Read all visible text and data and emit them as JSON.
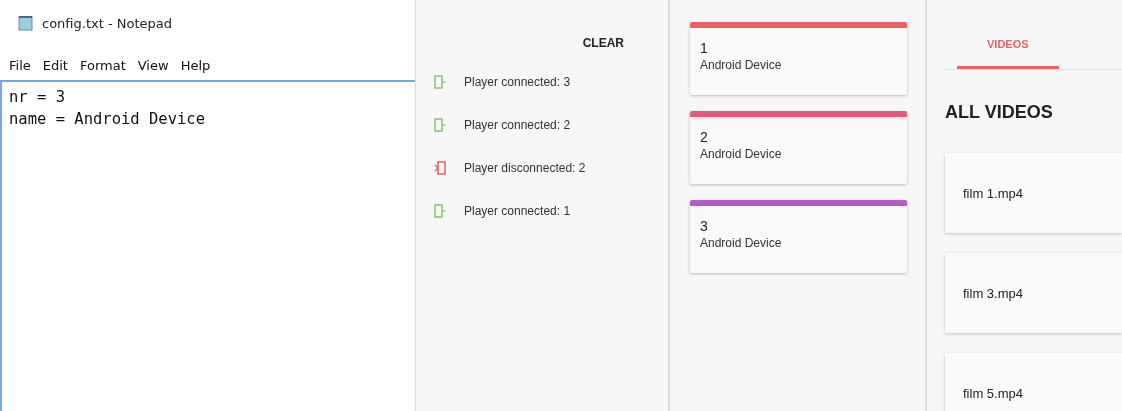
{
  "notepad": {
    "title": "config.txt - Notepad",
    "menu": [
      "File",
      "Edit",
      "Format",
      "View",
      "Help"
    ],
    "lines": [
      "nr = 3",
      "name = Android Device"
    ]
  },
  "events": {
    "clear_label": "CLEAR",
    "items": [
      {
        "kind": "connected",
        "text": "Player connected: 3"
      },
      {
        "kind": "connected",
        "text": "Player connected: 2"
      },
      {
        "kind": "disconnected",
        "text": "Player disconnected: 2"
      },
      {
        "kind": "connected",
        "text": "Player connected: 1"
      }
    ]
  },
  "players": [
    {
      "number": "1",
      "name": "Android Device",
      "color": "#e86464"
    },
    {
      "number": "2",
      "name": "Android Device",
      "color": "#e8587c"
    },
    {
      "number": "3",
      "name": "Android Device",
      "color": "#b45cc8"
    }
  ],
  "videos": {
    "tabs": [
      {
        "label": "VIDEOS",
        "selected": true
      }
    ],
    "heading": "ALL VIDEOS",
    "items": [
      "film 1.mp4",
      "film 3.mp4",
      "film 5.mp4"
    ]
  }
}
